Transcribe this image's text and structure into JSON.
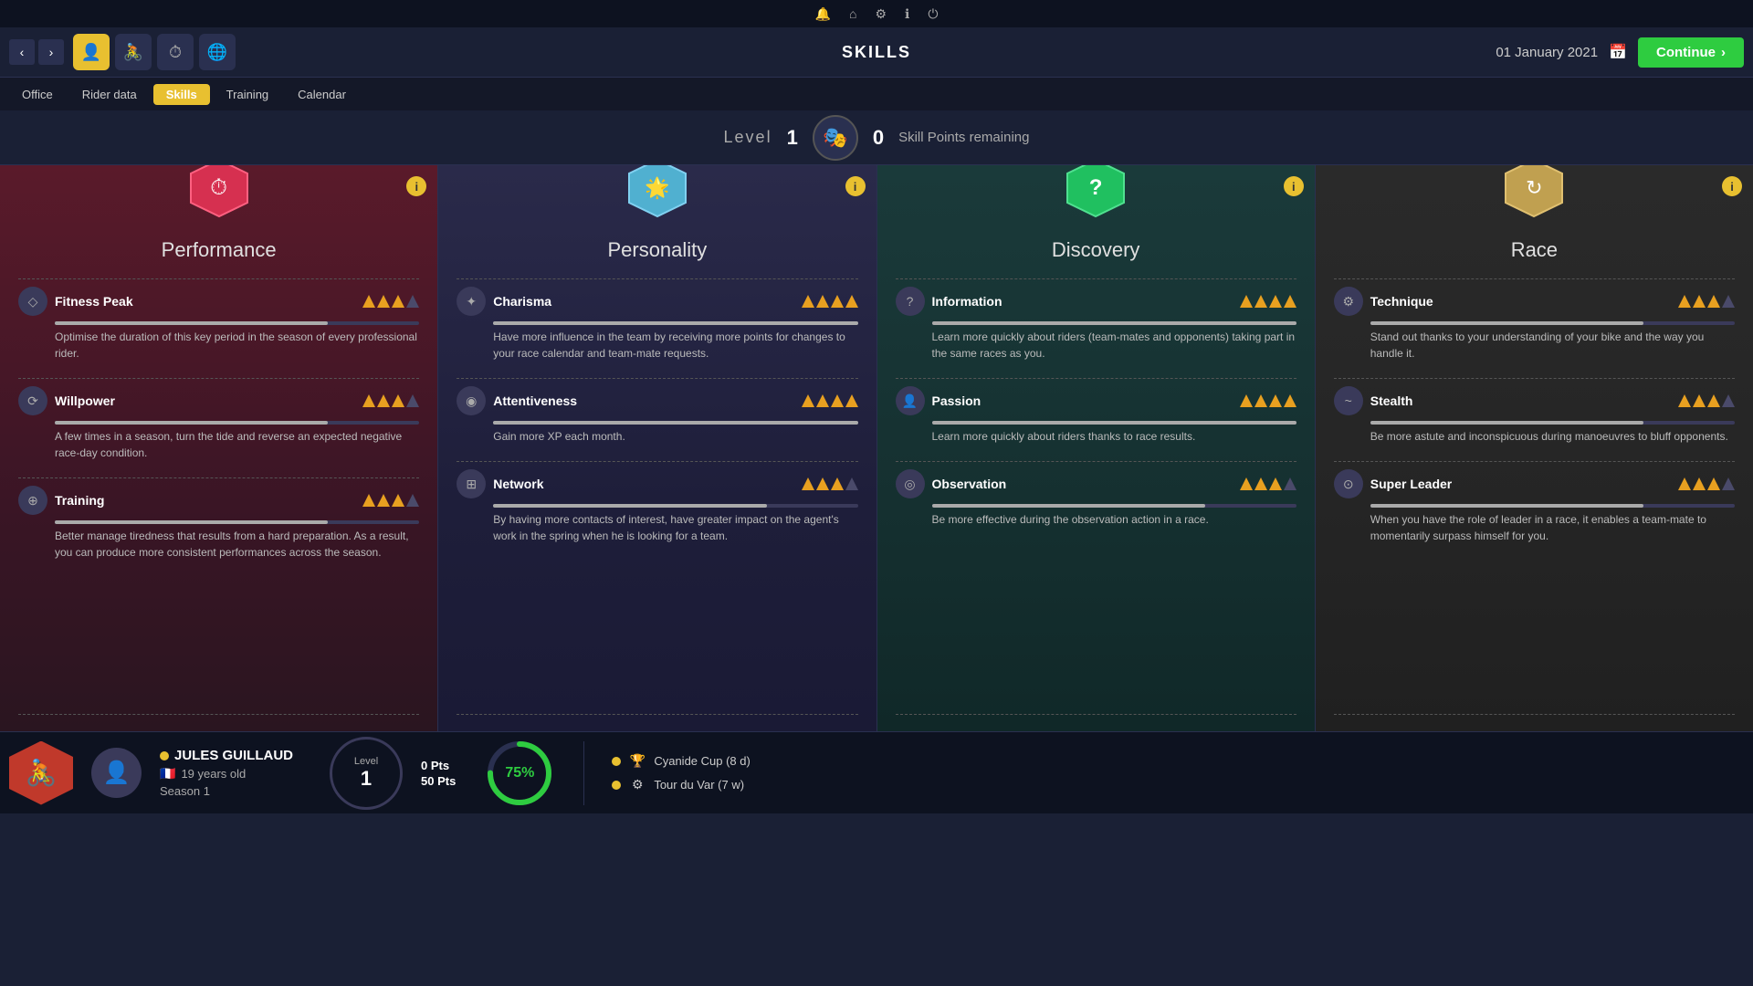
{
  "systemBar": {
    "icons": [
      "bell",
      "home",
      "gear",
      "info",
      "power"
    ]
  },
  "navBar": {
    "title": "SKILLS",
    "date": "01 January 2021",
    "continueLabel": "Continue",
    "tabs": [
      {
        "id": "nav-office",
        "label": "Office",
        "active": false
      },
      {
        "id": "nav-riderdata",
        "label": "Rider data",
        "active": false
      },
      {
        "id": "nav-skills",
        "label": "Skills",
        "active": true
      },
      {
        "id": "nav-training",
        "label": "Training",
        "active": false
      },
      {
        "id": "nav-calendar",
        "label": "Calendar",
        "active": false
      }
    ]
  },
  "levelBar": {
    "levelLabel": "Level",
    "levelNum": "1",
    "skillPointsNum": "0",
    "skillPointsLabel": "Skill Points remaining"
  },
  "cards": [
    {
      "id": "performance",
      "title": "Performance",
      "hexColor": "#d63050",
      "hexIcon": "⏱",
      "skills": [
        {
          "name": "Fitness Peak",
          "iconSymbol": "◇",
          "stars": 3,
          "totalStars": 4,
          "progress": 75,
          "desc": "Optimise the duration of this key period in the season of every professional rider."
        },
        {
          "name": "Willpower",
          "iconSymbol": "⟳",
          "stars": 3,
          "totalStars": 4,
          "progress": 75,
          "desc": "A few times in a season, turn the tide and reverse an expected negative race-day condition."
        },
        {
          "name": "Training",
          "iconSymbol": "⊕",
          "stars": 3,
          "totalStars": 4,
          "progress": 75,
          "desc": "Better manage tiredness that results from a hard preparation. As a result, you can produce more consistent performances across the season."
        }
      ]
    },
    {
      "id": "personality",
      "title": "Personality",
      "hexColor": "#50b0d0",
      "hexIcon": "🌟",
      "skills": [
        {
          "name": "Charisma",
          "iconSymbol": "✦",
          "stars": 4,
          "totalStars": 4,
          "progress": 100,
          "desc": "Have more influence in the team by receiving more points for changes to your race calendar and team-mate requests."
        },
        {
          "name": "Attentiveness",
          "iconSymbol": "◉",
          "stars": 4,
          "totalStars": 4,
          "progress": 100,
          "desc": "Gain more XP each month."
        },
        {
          "name": "Network",
          "iconSymbol": "⊞",
          "stars": 3,
          "totalStars": 4,
          "progress": 75,
          "desc": "By having more contacts of interest, have greater impact on the agent's work in the spring when he is looking for a team."
        }
      ]
    },
    {
      "id": "discovery",
      "title": "Discovery",
      "hexColor": "#20c060",
      "hexIcon": "?",
      "skills": [
        {
          "name": "Information",
          "iconSymbol": "?",
          "stars": 4,
          "totalStars": 4,
          "progress": 100,
          "desc": "Learn more quickly about riders (team-mates and opponents) taking part in the same races as you."
        },
        {
          "name": "Passion",
          "iconSymbol": "👤",
          "stars": 4,
          "totalStars": 4,
          "progress": 100,
          "desc": "Learn more quickly about riders thanks to race results."
        },
        {
          "name": "Observation",
          "iconSymbol": "◎",
          "stars": 3,
          "totalStars": 4,
          "progress": 75,
          "desc": "Be more effective during the observation action in a race."
        }
      ]
    },
    {
      "id": "race",
      "title": "Race",
      "hexColor": "#c0a050",
      "hexIcon": "↻",
      "skills": [
        {
          "name": "Technique",
          "iconSymbol": "⚙",
          "stars": 3,
          "totalStars": 4,
          "progress": 75,
          "desc": "Stand out thanks to your understanding of your bike and the way you handle it."
        },
        {
          "name": "Stealth",
          "iconSymbol": "~",
          "stars": 3,
          "totalStars": 4,
          "progress": 75,
          "desc": "Be more astute and inconspicuous during manoeuvres to bluff opponents."
        },
        {
          "name": "Super Leader",
          "iconSymbol": "⊙",
          "stars": 3,
          "totalStars": 4,
          "progress": 75,
          "desc": "When you have the role of leader in a race, it enables a team-mate to momentarily surpass himself for you."
        }
      ]
    }
  ],
  "bottomBar": {
    "riderName": "JULES GUILLAUD",
    "riderAge": "19 years old",
    "riderSeason": "Season 1",
    "levelLabel": "Level",
    "levelNum": "1",
    "currentPts": "0 Pts",
    "totalPts": "50 Pts",
    "progressPercent": "75%",
    "progressValue": 75,
    "races": [
      {
        "icon": "🏆",
        "name": "Cyanide Cup (8 d)"
      },
      {
        "icon": "⚙",
        "name": "Tour du Var (7 w)"
      }
    ]
  }
}
